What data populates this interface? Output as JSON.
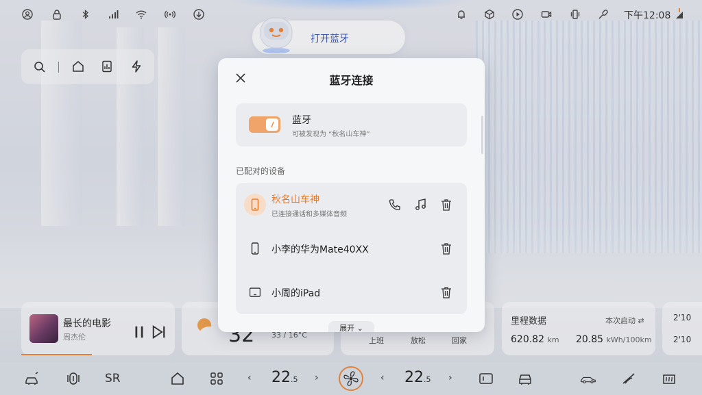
{
  "status_bar": {
    "time": "下午12:08",
    "icons": [
      "account-icon",
      "lock-icon",
      "bluetooth-icon",
      "signal-icon",
      "wifi-icon",
      "hotspot-icon",
      "download-icon",
      "bell-icon",
      "cube-icon",
      "play-icon",
      "camera-icon",
      "vibrate-icon",
      "mic-off-icon"
    ]
  },
  "assistant": {
    "label": "打开蓝牙"
  },
  "quickbar": {
    "icons": [
      "search-icon",
      "home-icon",
      "file-icon",
      "charge-icon"
    ]
  },
  "dialog": {
    "title": "蓝牙连接",
    "bluetooth": {
      "label": "蓝牙",
      "subtitle": "可被发现为 “秋名山车神”",
      "enabled": true
    },
    "section_label": "已配对的设备",
    "devices": [
      {
        "name": "秋名山车神",
        "status": "已连接通话和多媒体音频",
        "connected": true,
        "type": "phone"
      },
      {
        "name": "小李的华为Mate40XX",
        "status": "",
        "connected": false,
        "type": "phone"
      },
      {
        "name": "小周的iPad",
        "status": "",
        "connected": false,
        "type": "tablet"
      }
    ],
    "expand_label": "展开"
  },
  "music": {
    "title": "最长的电影",
    "artist": "周杰伦",
    "progress": 0.46
  },
  "weather": {
    "temp": "32",
    "range": "33 / 16°C"
  },
  "modes": [
    "上班",
    "放松",
    "回家"
  ],
  "trip": {
    "title": "里程数据",
    "toggle_label": "本次启动",
    "distance": "620.82",
    "distance_unit": "km",
    "consumption": "20.85",
    "consumption_unit": "kWh/100km"
  },
  "extra": {
    "line1": "2'10",
    "line2": "2'10"
  },
  "dock": {
    "sr_label": "SR",
    "left_temp": "22",
    "left_temp_decimal": ".5",
    "right_temp": "22",
    "right_temp_decimal": ".5"
  },
  "colors": {
    "accent": "#f08a3c",
    "assistant_text": "#3b5ab8",
    "connected": "#e87a2a"
  }
}
